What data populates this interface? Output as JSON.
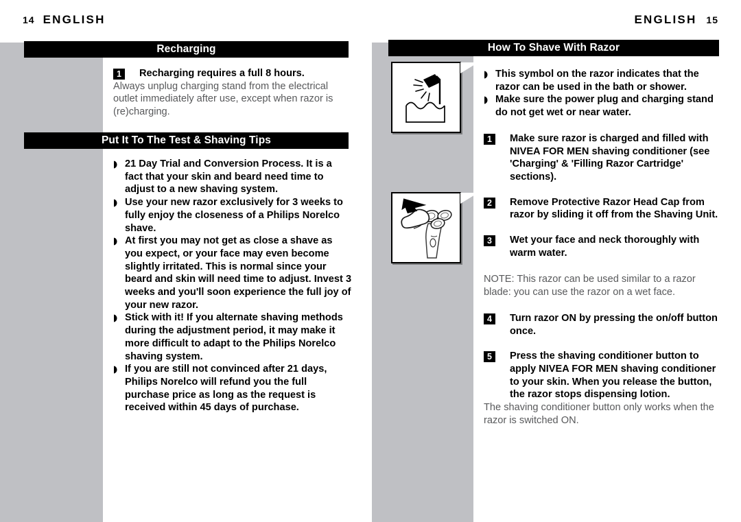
{
  "document": {
    "type": "product-manual-spread",
    "language": "ENGLISH",
    "colors": {
      "gray_panel": "#bfc0c4",
      "bar_background": "#000000",
      "bar_text": "#ffffff",
      "body_gray_text": "#58595b",
      "body_black_text": "#000000"
    }
  },
  "left_page": {
    "folio": "14",
    "running_head": "ENGLISH",
    "sections": [
      {
        "id": "recharging",
        "title": "Recharging",
        "step": {
          "number": "1",
          "text": "Recharging requires a full 8 hours."
        },
        "paragraph": "Always unplug charging stand from the electrical outlet immediately after use, except when razor is (re)charging."
      },
      {
        "id": "put-it-to-the-test",
        "title": "Put It To The Test & Shaving Tips",
        "bullets": [
          "21 Day Trial and Conversion Process. It is a fact that your skin and beard need time to adjust to a new shaving system.",
          "Use your new razor exclusively for 3 weeks to fully enjoy the closeness of a Philips Norelco shave.",
          "At first you may not get as close a shave as you expect, or your face may even become slightly irritated. This is normal since your beard and skin will need time to adjust. Invest 3 weeks and you'll soon experience the full joy of your new razor.",
          "Stick with it! If you alternate shaving methods during the adjustment period, it may make it more difficult to adapt to the Philips Norelco shaving system.",
          "If you are still not convinced after 21 days, Philips Norelco will refund you the full purchase price as long as the request is received within 45 days of purchase."
        ]
      }
    ]
  },
  "right_page": {
    "folio": "15",
    "running_head": "ENGLISH",
    "section": {
      "id": "how-to-shave-with-razor",
      "title": "How To Shave With Razor",
      "bullets": [
        "This symbol on the razor indicates that the razor can be used in the bath or shower.",
        "Make sure the power plug and charging stand do not get wet or near water."
      ],
      "steps": [
        {
          "number": "1",
          "text": "Make sure razor is charged and filled with NIVEA FOR MEN shaving conditioner (see 'Charging' & 'Filling Razor Cartridge' sections)."
        },
        {
          "number": "2",
          "text": "Remove Protective Razor Head Cap from razor by sliding it off from the Shaving Unit."
        },
        {
          "number": "3",
          "text": "Wet your face and neck thoroughly with warm water."
        }
      ],
      "note": "NOTE: This razor can be used similar to a razor blade: you can use the razor on a wet face.",
      "steps_after_note": [
        {
          "number": "4",
          "text": "Turn razor ON by pressing the on/off button once."
        },
        {
          "number": "5",
          "text": "Press the shaving conditioner button to apply NIVEA FOR MEN shaving conditioner to your skin. When you release the button, the razor stops dispensing lotion."
        }
      ],
      "footnote": "The shaving conditioner button only works when the razor is switched ON.",
      "illustrations": [
        {
          "id": "shower-water-symbol",
          "alt": "shower-head-over-water-basin-icon"
        },
        {
          "id": "remove-head-cap",
          "alt": "razor-with-protective-cap-removal-arrow-icon"
        }
      ]
    }
  }
}
